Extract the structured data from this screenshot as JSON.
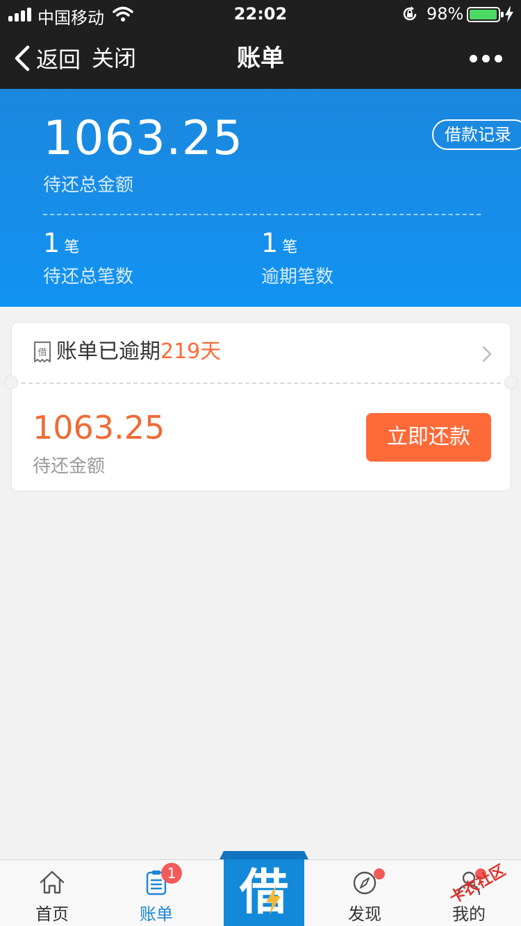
{
  "status_bar": {
    "carrier": "中国移动",
    "time": "22:02",
    "battery_percent": "98%",
    "battery_level": 0.98
  },
  "nav": {
    "back_label": "返回",
    "close_label": "关闭",
    "title": "账单"
  },
  "summary": {
    "total_amount": "1063.25",
    "total_amount_label": "待还总金额",
    "loan_record_label": "借款记录",
    "stats": [
      {
        "count": "1",
        "unit": "笔",
        "label": "待还总笔数"
      },
      {
        "count": "1",
        "unit": "笔",
        "label": "逾期笔数"
      }
    ]
  },
  "bill_card": {
    "icon_char": "借",
    "status_prefix": "账单已逾期",
    "overdue_days": "219天",
    "amount": "1063.25",
    "amount_label": "待还金额",
    "repay_button": "立即还款"
  },
  "tab_bar": {
    "tabs": [
      {
        "label": "首页",
        "icon": "home-icon",
        "active": false
      },
      {
        "label": "账单",
        "icon": "bill-icon",
        "active": true,
        "badge": "1"
      },
      {
        "label": "借",
        "icon": "borrow-bolt-icon",
        "center": true
      },
      {
        "label": "发现",
        "icon": "compass-icon",
        "dot": true
      },
      {
        "label": "我的",
        "icon": "person-icon",
        "dot": true
      }
    ]
  },
  "watermark": "卡农社区",
  "colors": {
    "header_blue": "#1193f2",
    "accent_orange": "#ff6a38",
    "active_tab": "#1a85d9",
    "badge_red": "#f35a5a",
    "battery_green": "#4cd964"
  }
}
